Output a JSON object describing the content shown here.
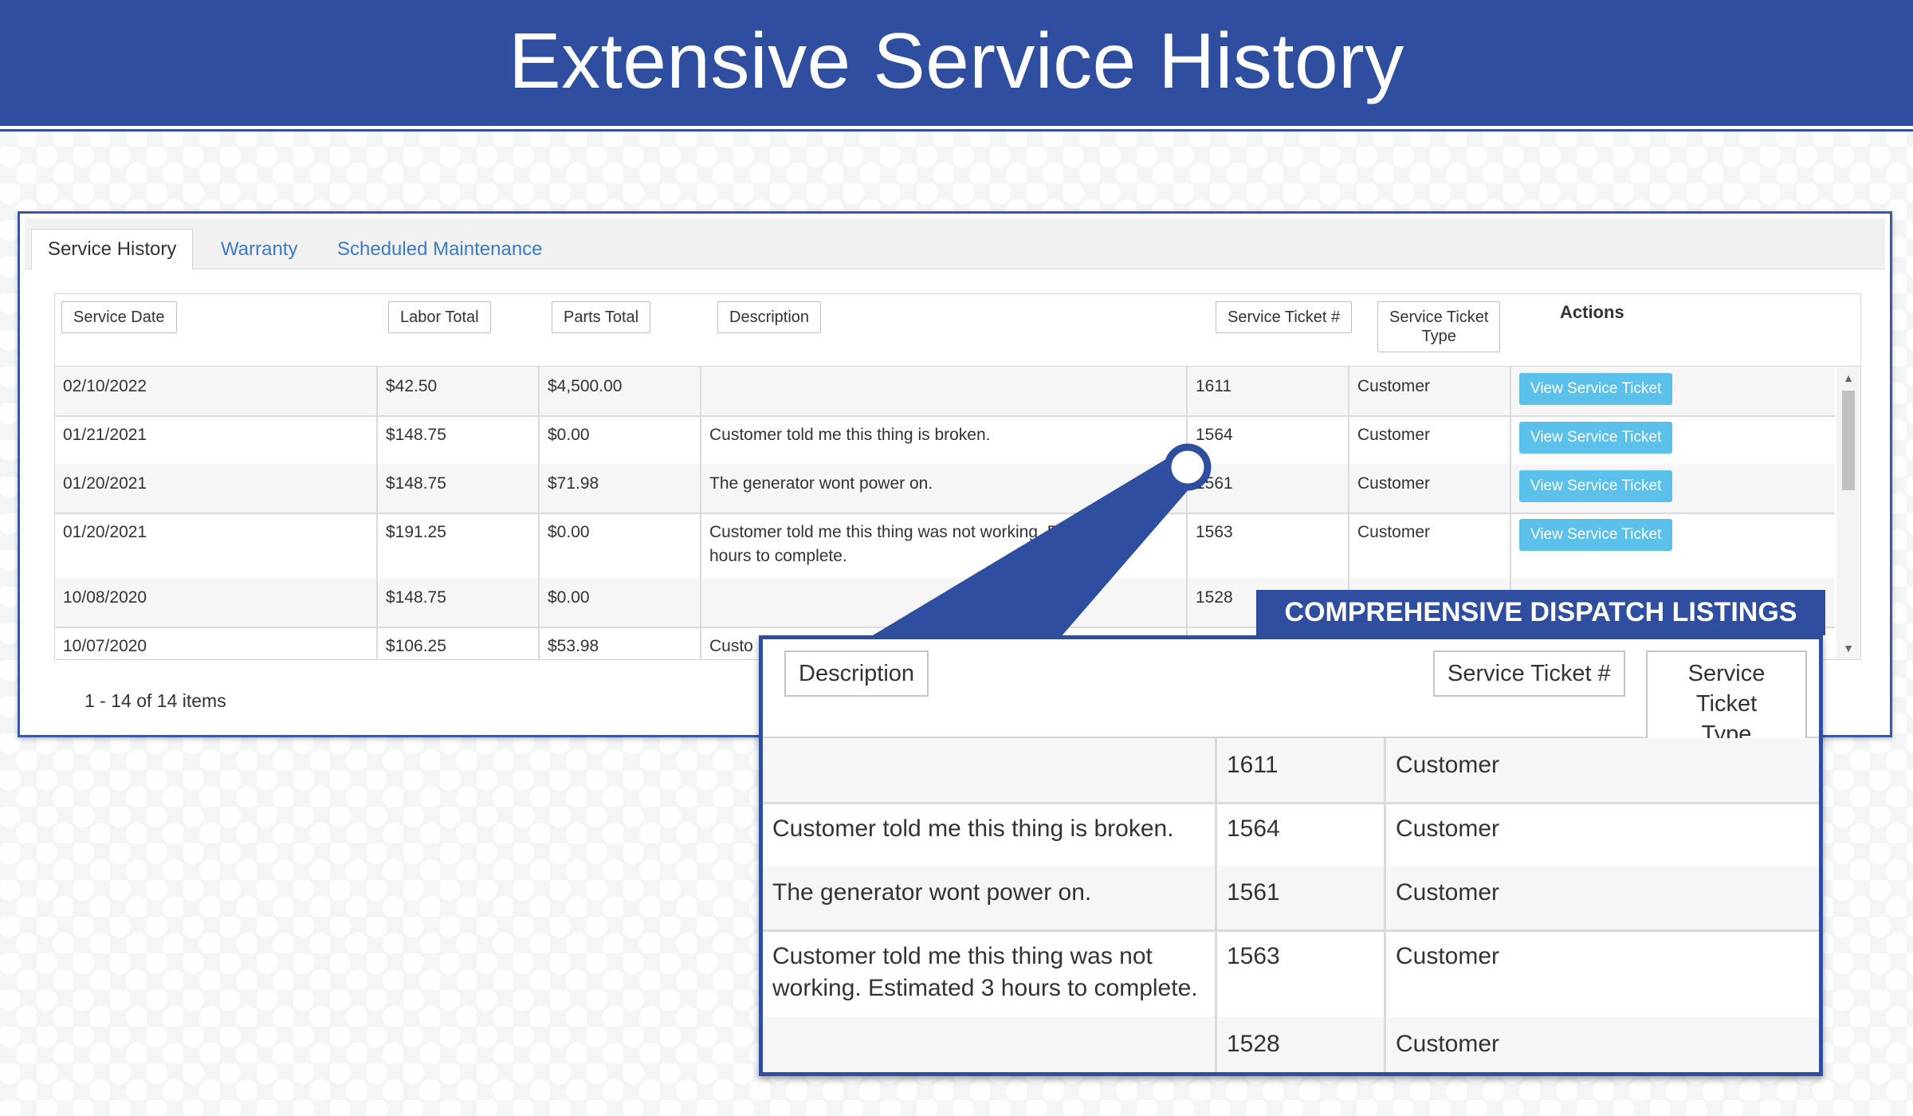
{
  "banner": {
    "title": "Extensive Service History"
  },
  "tabs": [
    {
      "label": "Service History",
      "active": true
    },
    {
      "label": "Warranty",
      "active": false
    },
    {
      "label": "Scheduled Maintenance",
      "active": false
    }
  ],
  "grid": {
    "columns": {
      "service_date": "Service Date",
      "labor_total": "Labor Total",
      "parts_total": "Parts Total",
      "description": "Description",
      "ticket_no": "Service Ticket #",
      "ticket_type_line1": "Service Ticket",
      "ticket_type_line2": "Type",
      "actions": "Actions"
    },
    "rows": [
      {
        "date": "02/10/2022",
        "labor": "$42.50",
        "parts": "$4,500.00",
        "description": "",
        "ticket": "1611",
        "type": "Customer",
        "action": "View Service Ticket"
      },
      {
        "date": "01/21/2021",
        "labor": "$148.75",
        "parts": "$0.00",
        "description": "Customer told me this thing is broken.",
        "ticket": "1564",
        "type": "Customer",
        "action": "View Service Ticket"
      },
      {
        "date": "01/20/2021",
        "labor": "$148.75",
        "parts": "$71.98",
        "description": "The generator wont power on.",
        "ticket": "1561",
        "type": "Customer",
        "action": "View Service Ticket"
      },
      {
        "date": "01/20/2021",
        "labor": "$191.25",
        "parts": "$0.00",
        "description": "Customer told me this thing was not working. Estimated 3 hours to complete.",
        "ticket": "1563",
        "type": "Customer",
        "action": "View Service Ticket"
      },
      {
        "date": "10/08/2020",
        "labor": "$148.75",
        "parts": "$0.00",
        "description": "",
        "ticket": "1528",
        "type": "Customer",
        "action": ""
      },
      {
        "date": "10/07/2020",
        "labor": "$106.25",
        "parts": "$53.98",
        "description": "Custo",
        "ticket": "",
        "type": "",
        "action": ""
      }
    ],
    "pager_text": "1 - 14 of 14 items"
  },
  "callout": {
    "label": "COMPREHENSIVE DISPATCH LISTINGS",
    "columns": {
      "description": "Description",
      "ticket_no": "Service Ticket #",
      "ticket_type_line1": "Service Ticket",
      "ticket_type_line2": "Type"
    },
    "rows": [
      {
        "description": "",
        "ticket": "1611",
        "type": "Customer"
      },
      {
        "description": "Customer told me this thing is broken.",
        "ticket": "1564",
        "type": "Customer"
      },
      {
        "description": "The generator wont power on.",
        "ticket": "1561",
        "type": "Customer"
      },
      {
        "description": "Customer told me this thing was not working. Estimated 3 hours to complete.",
        "ticket": "1563",
        "type": "Customer"
      },
      {
        "description": "",
        "ticket": "1528",
        "type": "Customer"
      }
    ]
  },
  "colors": {
    "brand": "#2f4ea0",
    "button": "#5bc0ea",
    "link": "#3a7bc8"
  },
  "icons": {
    "scroll_up": "scroll-up-arrow-icon",
    "scroll_down": "scroll-down-arrow-icon"
  }
}
